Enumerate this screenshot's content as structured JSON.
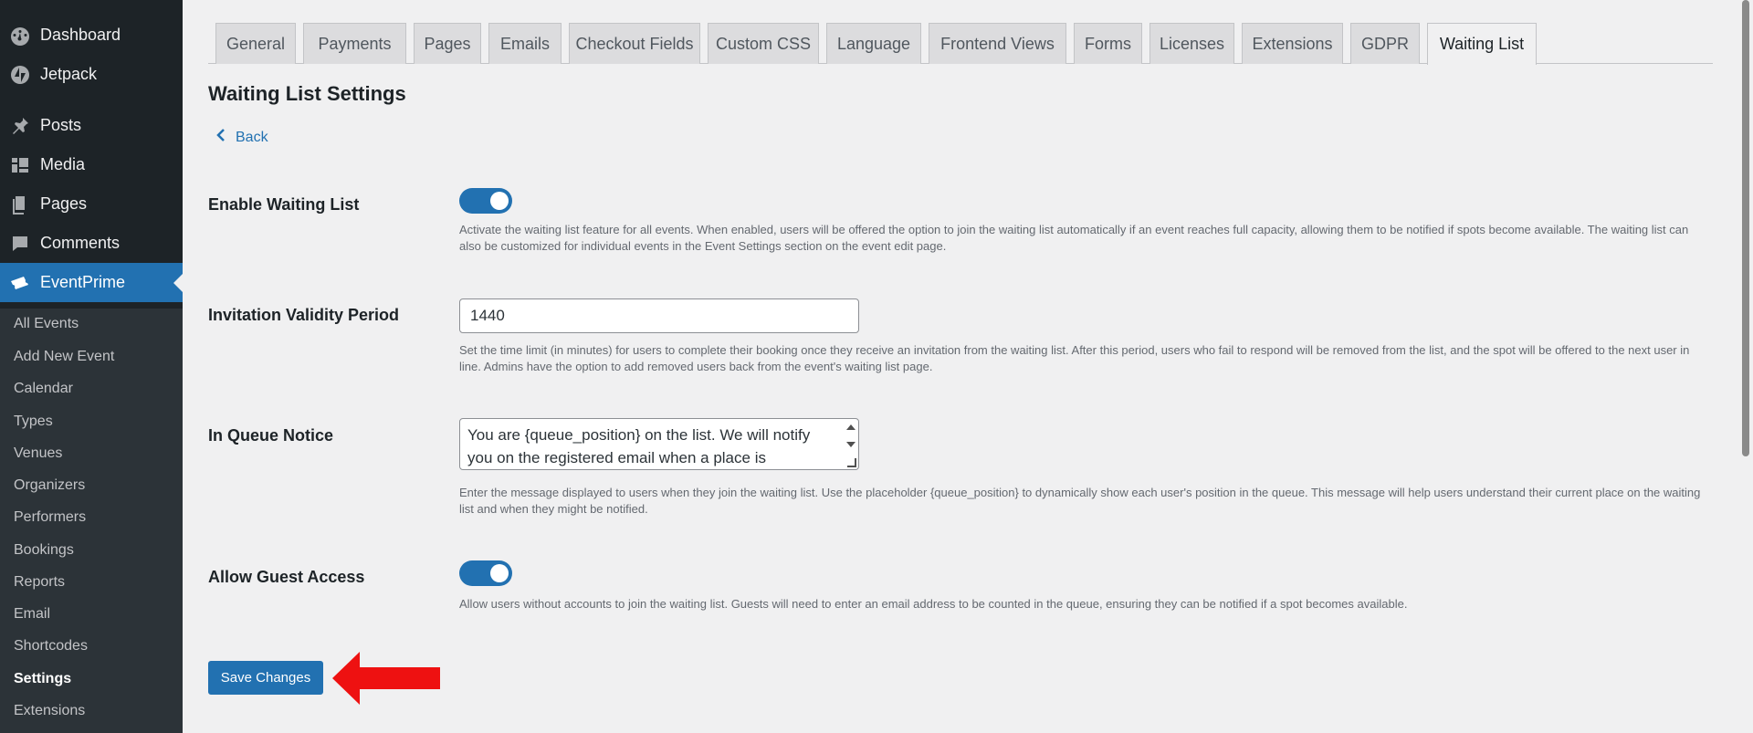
{
  "sidebar": {
    "menu": [
      {
        "label": "Dashboard",
        "icon": "dashboard-icon"
      },
      {
        "label": "Jetpack",
        "icon": "jetpack-icon"
      },
      {
        "label": "Posts",
        "icon": "pin-icon"
      },
      {
        "label": "Media",
        "icon": "media-icon"
      },
      {
        "label": "Pages",
        "icon": "pages-icon"
      },
      {
        "label": "Comments",
        "icon": "comments-icon"
      },
      {
        "label": "EventPrime",
        "icon": "tickets-icon"
      }
    ],
    "submenu": [
      {
        "label": "All Events"
      },
      {
        "label": "Add New Event"
      },
      {
        "label": "Calendar"
      },
      {
        "label": "Types"
      },
      {
        "label": "Venues"
      },
      {
        "label": "Organizers"
      },
      {
        "label": "Performers"
      },
      {
        "label": "Bookings"
      },
      {
        "label": "Reports"
      },
      {
        "label": "Email"
      },
      {
        "label": "Shortcodes"
      },
      {
        "label": "Settings"
      },
      {
        "label": "Extensions"
      }
    ],
    "accent_color": "#2271b1"
  },
  "tabs": [
    {
      "label": "General"
    },
    {
      "label": "Payments"
    },
    {
      "label": "Pages"
    },
    {
      "label": "Emails"
    },
    {
      "label": "Checkout Fields"
    },
    {
      "label": "Custom CSS"
    },
    {
      "label": "Language"
    },
    {
      "label": "Frontend Views"
    },
    {
      "label": "Forms"
    },
    {
      "label": "Licenses"
    },
    {
      "label": "Extensions"
    },
    {
      "label": "GDPR"
    },
    {
      "label": "Waiting List"
    }
  ],
  "page": {
    "title": "Waiting List Settings",
    "back_label": "Back"
  },
  "settings": {
    "enable_waiting_list": {
      "label": "Enable Waiting List",
      "enabled": true,
      "description": "Activate the waiting list feature for all events. When enabled, users will be offered the option to join the waiting list automatically if an event reaches full capacity, allowing them to be notified if spots become available. The waiting list can also be customized for individual events in the Event Settings section on the event edit page."
    },
    "invitation_validity": {
      "label": "Invitation Validity Period",
      "value": "1440",
      "description": "Set the time limit (in minutes) for users to complete their booking once they receive an invitation from the waiting list. After this period, users who fail to respond will be removed from the list, and the spot will be offered to the next user in line. Admins have the option to add removed users back from the event's waiting list page."
    },
    "in_queue_notice": {
      "label": "In Queue Notice",
      "value": "You are {queue_position} on the list. We will notify you on the registered email when a place is",
      "description": "Enter the message displayed to users when they join the waiting list. Use the placeholder {queue_position} to dynamically show each user's position in the queue. This message will help users understand their current place on the waiting list and when they might be notified."
    },
    "allow_guest_access": {
      "label": "Allow Guest Access",
      "enabled": true,
      "description": "Allow users without accounts to join the waiting list. Guests will need to enter an email address to be counted in the queue, ensuring they can be notified if a spot becomes available."
    }
  },
  "save_button": {
    "label": "Save Changes"
  }
}
